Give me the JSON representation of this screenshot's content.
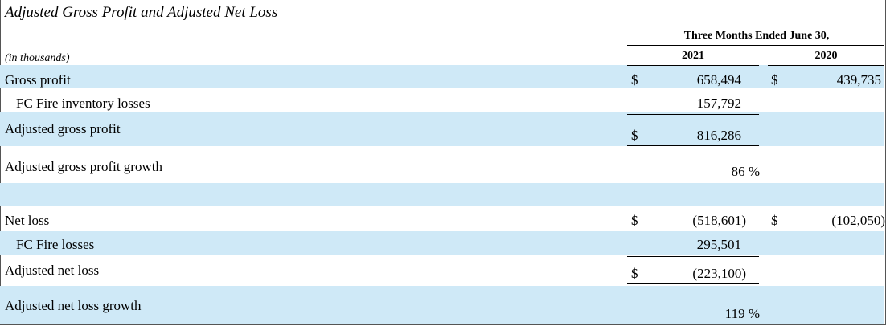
{
  "title": "Adjusted Gross Profit and Adjusted Net Loss",
  "units": "(in thousands)",
  "header": {
    "period": "Three Months Ended June 30,",
    "col_2021": "2021",
    "col_2020": "2020"
  },
  "rows": {
    "gross_profit": {
      "label": "Gross profit",
      "dollar_2021": "$",
      "v2021": "658,494",
      "dollar_2020": "$",
      "v2020": "439,735"
    },
    "fc_fire_inventory": {
      "label": "FC Fire inventory losses",
      "v2021": "157,792"
    },
    "adjusted_gross_profit": {
      "label": "Adjusted gross profit",
      "dollar_2021": "$",
      "v2021": "816,286"
    },
    "adjusted_gross_profit_growth": {
      "label": "Adjusted gross profit growth",
      "v2021": "86 %"
    },
    "net_loss": {
      "label": "Net loss",
      "dollar_2021": "$",
      "v2021": "(518,601)",
      "dollar_2020": "$",
      "v2020": "(102,050)"
    },
    "fc_fire_losses": {
      "label": "FC Fire losses",
      "v2021": "295,501"
    },
    "adjusted_net_loss": {
      "label": "Adjusted net loss",
      "dollar_2021": "$",
      "v2021": "(223,100)"
    },
    "adjusted_net_loss_growth": {
      "label": "Adjusted net loss growth",
      "v2021": "119 %"
    }
  },
  "colors": {
    "band": "#cfe9f7"
  }
}
